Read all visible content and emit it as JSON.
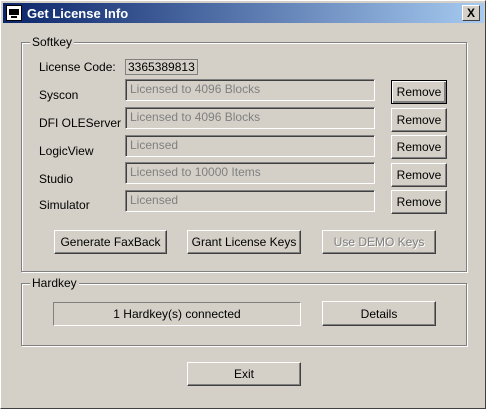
{
  "window": {
    "title": "Get License Info",
    "close_label": "X"
  },
  "softkey": {
    "label": "Softkey",
    "license_code_label": "License Code:",
    "license_code_value": "3365389813",
    "items": [
      {
        "label": "Syscon",
        "value": "Licensed to 4096 Blocks",
        "button": "Remove"
      },
      {
        "label": "DFI OLEServer",
        "value": "Licensed to 4096 Blocks",
        "button": "Remove"
      },
      {
        "label": "LogicView",
        "value": "Licensed",
        "button": "Remove"
      },
      {
        "label": "Studio",
        "value": "Licensed to 10000 Items",
        "button": "Remove"
      },
      {
        "label": "Simulator",
        "value": "Licensed",
        "button": "Remove"
      }
    ],
    "actions": {
      "generate_faxback": "Generate FaxBack",
      "grant_license_keys": "Grant License Keys",
      "use_demo_keys": "Use DEMO Keys"
    }
  },
  "hardkey": {
    "label": "Hardkey",
    "status": "1 Hardkey(s) connected",
    "details_button": "Details"
  },
  "footer": {
    "exit_button": "Exit"
  }
}
